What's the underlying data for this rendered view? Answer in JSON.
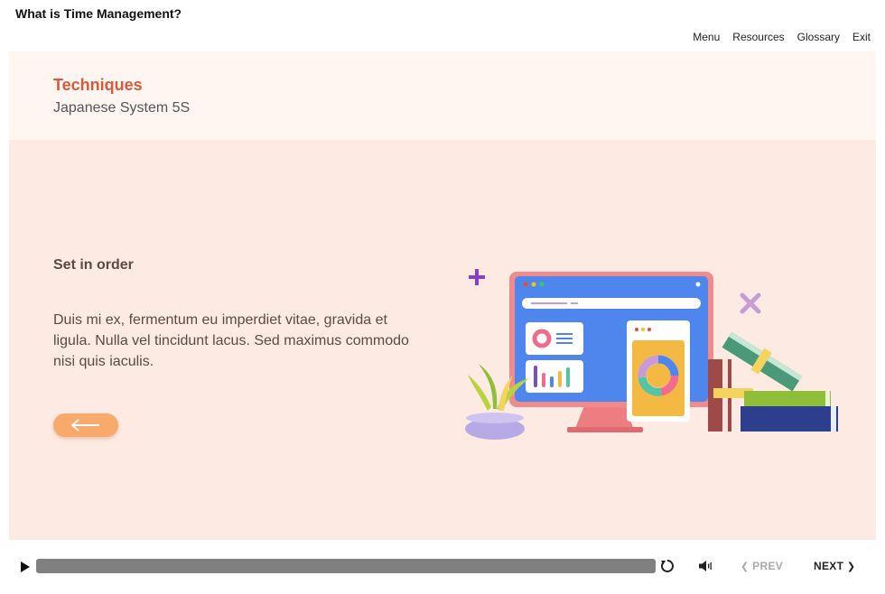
{
  "course": {
    "title": "What is Time Management?"
  },
  "nav": {
    "menu": "Menu",
    "resources": "Resources",
    "glossary": "Glossary",
    "exit": "Exit"
  },
  "header": {
    "title": "Techniques",
    "subtitle": "Japanese System 5S"
  },
  "content": {
    "heading": "Set in order",
    "body": "Duis mi ex, fermentum eu imperdiet vitae, gravida et ligula. Nulla vel tincidunt lacus. Sed maximus commodo nisi quis iaculis."
  },
  "player": {
    "prev_label": "PREV",
    "next_label": "NEXT",
    "prev_enabled": false
  },
  "colors": {
    "accent": "#d95a3b",
    "header_bg": "#fff6f2",
    "content_bg": "#fdebe3",
    "button_orange": "#f8a96c",
    "progress_gray": "#808080"
  },
  "icons": {
    "back": "arrow-left-icon",
    "play": "play-icon",
    "replay": "replay-icon",
    "volume": "volume-icon",
    "prev": "chevron-left-icon",
    "next": "chevron-right-icon"
  }
}
